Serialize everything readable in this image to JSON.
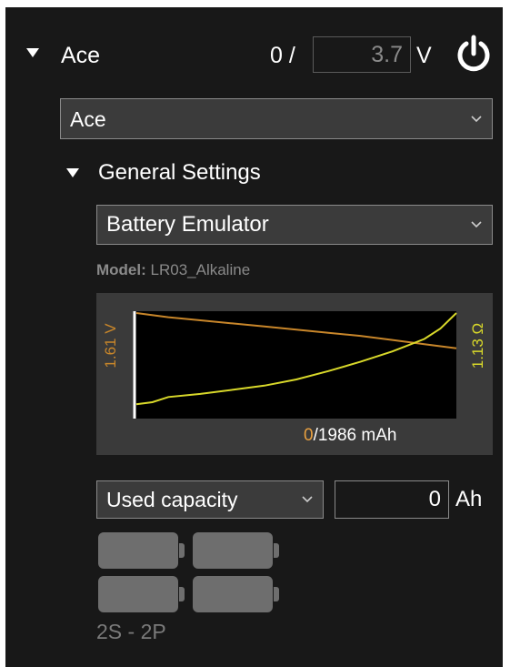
{
  "header": {
    "device_name": "Ace",
    "voltage_current": "0 /",
    "voltage_setpoint": "3.7",
    "voltage_unit": "V"
  },
  "device_select": {
    "value": "Ace"
  },
  "general_settings": {
    "title": "General Settings",
    "mode_select": "Battery Emulator",
    "model_label": "Model:",
    "model_value": "LR03_Alkaline"
  },
  "chart_data": {
    "type": "line",
    "y_left_label": "1.61 V",
    "y_right_label": "1.13 Ω",
    "capacity_used": "0",
    "capacity_total": "/1986 mAh",
    "series": [
      {
        "name": "Voltage",
        "color": "#c8862a",
        "x": [
          0,
          0.1,
          0.2,
          0.3,
          0.4,
          0.5,
          0.6,
          0.7,
          0.8,
          0.9,
          1.0
        ],
        "y": [
          1.0,
          0.96,
          0.93,
          0.9,
          0.87,
          0.84,
          0.81,
          0.78,
          0.74,
          0.7,
          0.66
        ]
      },
      {
        "name": "Resistance",
        "color": "#d8d82a",
        "x": [
          0,
          0.05,
          0.1,
          0.2,
          0.3,
          0.4,
          0.5,
          0.6,
          0.7,
          0.8,
          0.9,
          0.95,
          1.0
        ],
        "y": [
          0.12,
          0.14,
          0.19,
          0.22,
          0.26,
          0.3,
          0.36,
          0.44,
          0.53,
          0.63,
          0.75,
          0.85,
          1.0
        ]
      }
    ]
  },
  "capacity": {
    "mode_select": "Used capacity",
    "value": "0",
    "unit": "Ah"
  },
  "configuration": {
    "label": "2S - 2P"
  },
  "colors": {
    "panel_bg": "#181818",
    "field_bg": "#3b3b3b",
    "chart_bg": "#3a3a3a",
    "voltage": "#c8862a",
    "resistance": "#d8d82a"
  }
}
